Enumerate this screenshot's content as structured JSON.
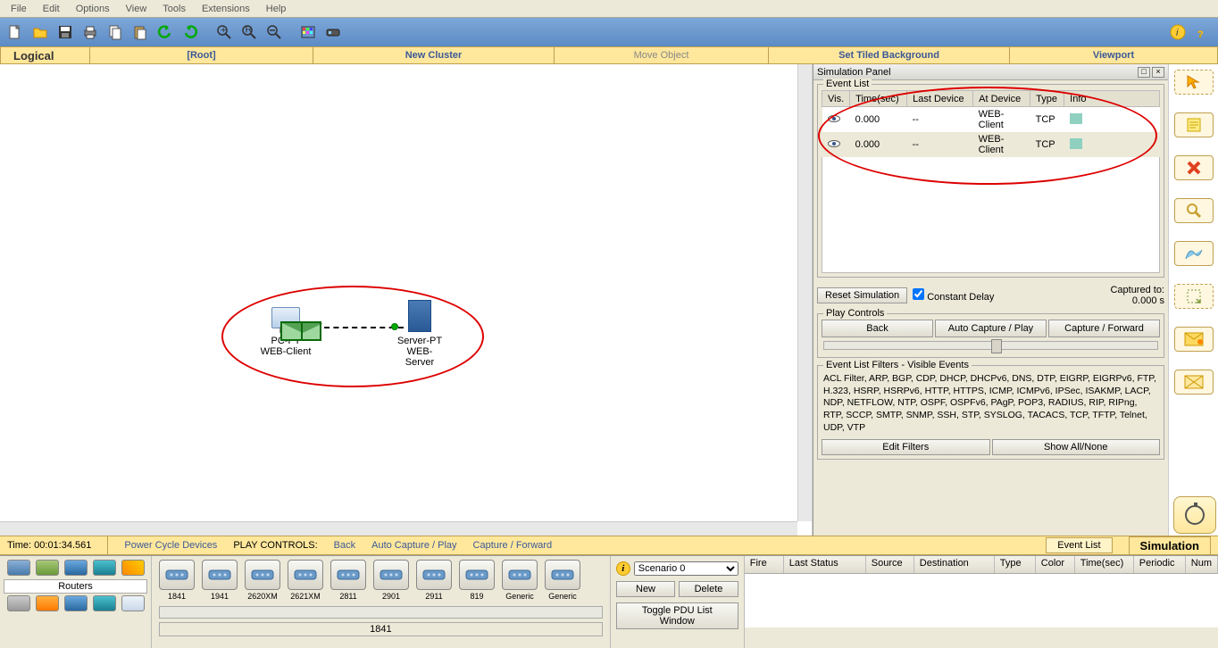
{
  "menu": {
    "file": "File",
    "edit": "Edit",
    "options": "Options",
    "view": "View",
    "tools": "Tools",
    "extensions": "Extensions",
    "help": "Help"
  },
  "nav": {
    "logical": "Logical",
    "root": "[Root]",
    "newcluster": "New Cluster",
    "moveobj": "Move Object",
    "tiledbg": "Set Tiled Background",
    "viewport": "Viewport"
  },
  "topology": {
    "pc": {
      "line1": "PC-PT",
      "line2": "WEB-Client"
    },
    "server": {
      "line1": "Server-PT",
      "line2": "WEB-Server"
    }
  },
  "sim": {
    "title": "Simulation Panel",
    "eventlist": "Event List",
    "cols": {
      "vis": "Vis.",
      "time": "Time(sec)",
      "last": "Last Device",
      "at": "At Device",
      "type": "Type",
      "info": "Info"
    },
    "rows": [
      {
        "time": "0.000",
        "last": "--",
        "at": "WEB-Client",
        "type": "TCP"
      },
      {
        "time": "0.000",
        "last": "--",
        "at": "WEB-Client",
        "type": "TCP"
      }
    ],
    "reset": "Reset Simulation",
    "constdelay": "Constant Delay",
    "captured_lbl": "Captured to:",
    "captured_val": "0.000 s",
    "playcontrols": "Play Controls",
    "back": "Back",
    "autocap": "Auto Capture / Play",
    "capfwd": "Capture / Forward",
    "filters_title": "Event List Filters - Visible Events",
    "filters_text": "ACL Filter, ARP, BGP, CDP, DHCP, DHCPv6, DNS, DTP, EIGRP, EIGRPv6, FTP, H.323, HSRP, HSRPv6, HTTP, HTTPS, ICMP, ICMPv6, IPSec, ISAKMP, LACP, NDP, NETFLOW, NTP, OSPF, OSPFv6, PAgP, POP3, RADIUS, RIP, RIPng, RTP, SCCP, SMTP, SNMP, SSH, STP, SYSLOG, TACACS, TCP, TFTP, Telnet, UDP, VTP",
    "editfilters": "Edit Filters",
    "showall": "Show All/None"
  },
  "bottom": {
    "time": "Time: 00:01:34.561",
    "powercycle": "Power Cycle Devices",
    "playlabel": "PLAY CONTROLS:",
    "back": "Back",
    "auto": "Auto Capture / Play",
    "capfwd": "Capture / Forward",
    "eventlist": "Event List",
    "simulation": "Simulation"
  },
  "devcat": {
    "label": "Routers"
  },
  "devlist": {
    "items": [
      "1841",
      "1941",
      "2620XM",
      "2621XM",
      "2811",
      "2901",
      "2911",
      "819",
      "Generic",
      "Generic"
    ],
    "selected": "1841"
  },
  "scen": {
    "select": "Scenario 0",
    "new": "New",
    "delete": "Delete",
    "toggle": "Toggle PDU List Window"
  },
  "pdu": {
    "fire": "Fire",
    "last": "Last Status",
    "source": "Source",
    "dest": "Destination",
    "type": "Type",
    "color": "Color",
    "time": "Time(sec)",
    "periodic": "Periodic",
    "num": "Num"
  }
}
